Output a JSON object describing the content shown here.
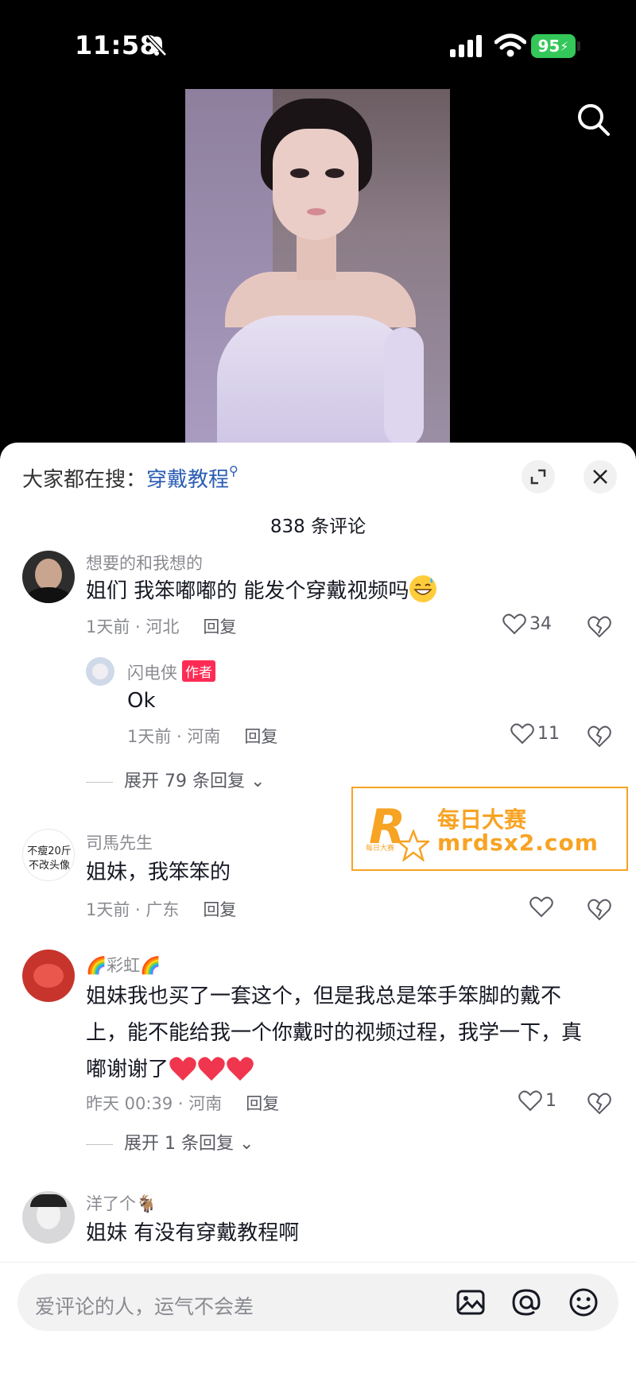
{
  "status_bar": {
    "time": "11:58",
    "battery": "95"
  },
  "top_bar": {
    "search_icon": "search-icon"
  },
  "hot_search": {
    "prefix": "大家都在搜：",
    "term": "穿戴教程",
    "suffix_icon": "magnifier-icon"
  },
  "comment_count": "838 条评论",
  "comments": [
    {
      "user": "想要的和我想的",
      "text": "姐们 我笨嘟嘟的 能发个穿戴视频吗",
      "emoji": "grinning-sweat-emoji",
      "time_location": "1天前 · 河北",
      "reply": "回复",
      "likes": "34"
    },
    {
      "user": "闪电侠",
      "badge": "作者",
      "text": "Ok",
      "time_location": "1天前 · 河南",
      "reply": "回复",
      "likes": "11"
    },
    {
      "expand": "展开 79 条回复"
    },
    {
      "avatar_text_line1": "不瘦20斤",
      "avatar_text_line2": "不改头像",
      "user": "司馬先生",
      "text": "姐妹，我笨笨的",
      "time_location": "1天前 · 广东",
      "reply": "回复",
      "likes": ""
    },
    {
      "user": "彩虹",
      "text_line1": "姐妹我也买了一套这个，但是我总是笨手笨脚的戴不",
      "text_line2": "上，能不能给我一个你戴时的视频过程，我学一下，真",
      "text_line3": "嘟谢谢了",
      "time_location": "昨天 00:39 · 河南",
      "reply": "回复",
      "likes": "1"
    },
    {
      "expand": "展开 1 条回复"
    },
    {
      "user": "洋了个",
      "text": "姐妹 有没有穿戴教程啊"
    }
  ],
  "watermark": {
    "cn": "每日大赛",
    "url": "mrdsx2.com",
    "small": "每日大赛"
  },
  "input": {
    "placeholder": "爱评论的人，运气不会差"
  },
  "colors": {
    "accent_link": "#2b5db5",
    "author_badge": "#fe2c55",
    "watermark": "#f7a323"
  }
}
